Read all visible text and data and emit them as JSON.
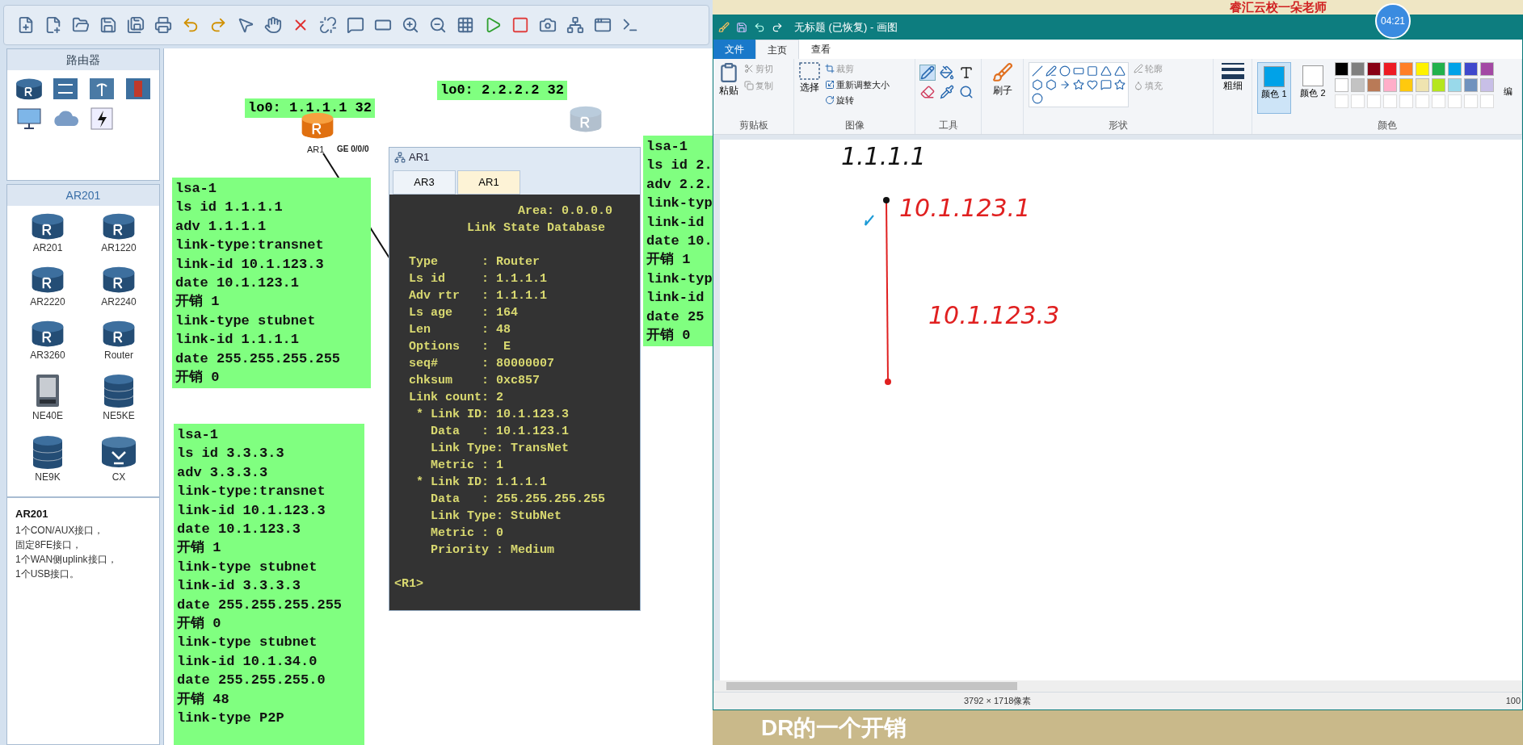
{
  "ensp": {
    "palette": {
      "header": "路由器",
      "section": "AR201",
      "devices": [
        {
          "label": "AR201",
          "kind": "router"
        },
        {
          "label": "AR1220",
          "kind": "router"
        },
        {
          "label": "AR2220",
          "kind": "router"
        },
        {
          "label": "AR2240",
          "kind": "router"
        },
        {
          "label": "AR3260",
          "kind": "router"
        },
        {
          "label": "Router",
          "kind": "router"
        },
        {
          "label": "NE40E",
          "kind": "chassis"
        },
        {
          "label": "NE5KE",
          "kind": "stack"
        },
        {
          "label": "NE9K",
          "kind": "stack"
        },
        {
          "label": "CX",
          "kind": "cx"
        }
      ],
      "info": {
        "title": "AR201",
        "lines": [
          "1个CON/AUX接口，",
          "固定8FE接口，",
          "1个WAN侧uplink接口，",
          "1个USB接口。"
        ]
      }
    },
    "canvas": {
      "labels": [
        {
          "text": "lo0: 1.1.1.1 32"
        },
        {
          "text": "lo0: 2.2.2.2 32"
        }
      ],
      "nodes": [
        {
          "label": "AR1",
          "port": "GE 0/0/0",
          "active": true
        },
        {
          "active": false
        }
      ],
      "notes": [
        {
          "lines": [
            "lsa-1",
            "ls id 1.1.1.1",
            "adv 1.1.1.1",
            "link-type:transnet",
            "link-id 10.1.123.3",
            "date 10.1.123.1",
            "开销 1",
            "link-type stubnet",
            "link-id 1.1.1.1",
            "date 255.255.255.255",
            "开销 0"
          ]
        },
        {
          "lines": [
            "lsa-1",
            "ls id 3.3.3.3",
            "adv 3.3.3.3",
            "link-type:transnet",
            "link-id 10.1.123.3",
            "date 10.1.123.3",
            "开销 1",
            "link-type stubnet",
            "link-id 3.3.3.3",
            "date 255.255.255.255",
            "开销 0",
            "link-type stubnet",
            "link-id 10.1.34.0",
            "date 255.255.255.0",
            "开销 48",
            "link-type P2P"
          ]
        },
        {
          "lines": [
            "lsa-1",
            "ls id 2.",
            "adv 2.2.",
            "link-typ",
            "link-id",
            "date 10.",
            "开销 1",
            "link-typ",
            "link-id",
            "date 25",
            "开销 0"
          ]
        }
      ]
    },
    "console": {
      "title": "AR1",
      "tabs": [
        {
          "label": "AR3",
          "selected": false
        },
        {
          "label": "AR1",
          "selected": true
        }
      ],
      "header": [
        "                 Area: 0.0.0.0",
        "          Link State Database"
      ],
      "lines": [
        "  Type      : Router",
        "  Ls id     : 1.1.1.1",
        "  Adv rtr   : 1.1.1.1",
        "  Ls age    : 164",
        "  Len       : 48",
        "  Options   :  E",
        "  seq#      : 80000007",
        "  chksum    : 0xc857",
        "  Link count: 2",
        "   * Link ID: 10.1.123.3",
        "     Data   : 10.1.123.1",
        "     Link Type: TransNet",
        "     Metric : 1",
        "   * Link ID: 1.1.1.1",
        "     Data   : 255.255.255.255",
        "     Link Type: StubNet",
        "     Metric : 0",
        "     Priority : Medium"
      ],
      "prompt": "<R1>"
    }
  },
  "banner": {
    "text": "睿汇云校一朵老师",
    "timer": "04:21"
  },
  "paint": {
    "title": "无标题 (已恢复) - 画图",
    "tabs": [
      {
        "label": "文件",
        "kind": "file"
      },
      {
        "label": "主页",
        "kind": "tab",
        "selected": true
      },
      {
        "label": "查看",
        "kind": "tab",
        "selected": false
      }
    ],
    "groups": [
      {
        "label": "剪贴板",
        "big": "粘贴",
        "items": [
          "剪切",
          "复制"
        ]
      },
      {
        "label": "图像",
        "big": "选择",
        "items": [
          "裁剪",
          "重新调整大小",
          "旋转"
        ]
      },
      {
        "label": "工具"
      },
      {
        "label": "形状",
        "side": [
          "轮廓",
          "填充"
        ]
      },
      {
        "label": "颜色"
      }
    ],
    "brush": "刷子",
    "size": "粗细",
    "color1": {
      "label": "颜色 1",
      "color": "#00a2e8",
      "selected": true
    },
    "color2": {
      "label": "颜色 2",
      "color": "#ffffff",
      "selected": false
    },
    "edit_colors": "编",
    "swatches": [
      {
        "color": "#000000"
      },
      {
        "color": "#7f7f7f"
      },
      {
        "color": "#880015"
      },
      {
        "color": "#ed1c24"
      },
      {
        "color": "#ff7f27"
      },
      {
        "color": "#fff200"
      },
      {
        "color": "#22b14c"
      },
      {
        "color": "#00a2e8"
      },
      {
        "color": "#3f48cc"
      },
      {
        "color": "#a349a4"
      },
      {
        "color": "#ffffff"
      },
      {
        "color": "#c3c3c3"
      },
      {
        "color": "#b97a57"
      },
      {
        "color": "#ffaec9"
      },
      {
        "color": "#ffc90e"
      },
      {
        "color": "#efe4b0"
      },
      {
        "color": "#b5e61d"
      },
      {
        "color": "#99d9ea"
      },
      {
        "color": "#7092be"
      },
      {
        "color": "#c8bfe7"
      }
    ],
    "sketch": [
      {
        "text": "1.1.1.1",
        "color": "#111111"
      },
      {
        "text": "10.1.123.1",
        "color": "#e02020"
      },
      {
        "text": "10.1.123.3",
        "color": "#e02020"
      }
    ],
    "status": {
      "size": "3792 × 1718像素",
      "zoom": "100"
    }
  },
  "subtitle": "DR的一个开销"
}
